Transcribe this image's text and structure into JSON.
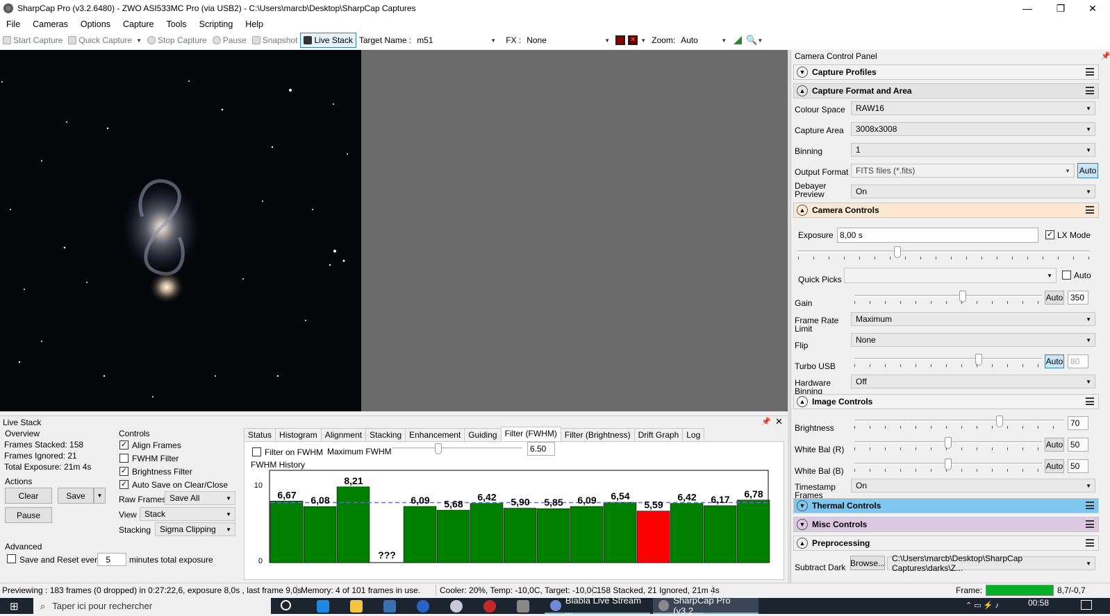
{
  "window": {
    "title": "SharpCap Pro (v3.2.6480) - ZWO ASI533MC Pro (via USB2) - C:\\Users\\marcb\\Desktop\\SharpCap Captures",
    "minimize": "—",
    "maximize": "❐",
    "close": "✕"
  },
  "menu": [
    "File",
    "Cameras",
    "Options",
    "Capture",
    "Tools",
    "Scripting",
    "Help"
  ],
  "toolbar": {
    "start_capture": "Start Capture",
    "quick_capture": "Quick Capture",
    "stop_capture": "Stop Capture",
    "pause": "Pause",
    "snapshot": "Snapshot",
    "live_stack": "Live Stack",
    "target_label": "Target Name :",
    "target_value": "m51",
    "fx_label": "FX :",
    "fx_value": "None",
    "zoom_label": "Zoom:",
    "zoom_value": "Auto"
  },
  "ccp": {
    "title": "Camera Control Panel",
    "sections": {
      "capture_profiles": "Capture Profiles",
      "capture_format": "Capture Format and Area",
      "camera_controls": "Camera Controls",
      "image_controls": "Image Controls",
      "thermal_controls": "Thermal Controls",
      "misc_controls": "Misc Controls",
      "preprocessing": "Preprocessing"
    },
    "colour_space": {
      "label": "Colour Space",
      "value": "RAW16"
    },
    "capture_area": {
      "label": "Capture Area",
      "value": "3008x3008"
    },
    "binning": {
      "label": "Binning",
      "value": "1"
    },
    "output_format": {
      "label": "Output Format",
      "value": "FITS files (*.fits)",
      "auto": "Auto"
    },
    "debayer": {
      "label1": "Debayer",
      "label2": "Preview",
      "value": "On"
    },
    "exposure": {
      "label": "Exposure",
      "value": "8,00 s",
      "lx": "LX Mode"
    },
    "quick_picks": {
      "label": "Quick Picks",
      "auto": "Auto"
    },
    "gain": {
      "label": "Gain",
      "auto": "Auto",
      "value": "350",
      "level": 0.58
    },
    "frame_rate": {
      "label1": "Frame Rate",
      "label2": "Limit",
      "value": "Maximum"
    },
    "flip": {
      "label": "Flip",
      "value": "None"
    },
    "turbo_usb": {
      "label": "Turbo USB",
      "auto": "Auto",
      "value": "80",
      "level": 0.67
    },
    "hw_binning": {
      "label1": "Hardware",
      "label2": "Binning",
      "value": "Off"
    },
    "brightness": {
      "label": "Brightness",
      "value": "70",
      "level": 0.7
    },
    "wb_r": {
      "label": "White Bal (R)",
      "auto": "Auto",
      "value": "50",
      "level": 0.5
    },
    "wb_b": {
      "label": "White Bal (B)",
      "auto": "Auto",
      "value": "50",
      "level": 0.5
    },
    "timestamp": {
      "label1": "Timestamp",
      "label2": "Frames",
      "value": "On"
    },
    "subtract_dark": {
      "label": "Subtract Dark",
      "browse": "Browse...",
      "path": "C:\\Users\\marcb\\Desktop\\SharpCap Captures\\darks\\Z..."
    }
  },
  "livestack": {
    "title": "Live Stack",
    "overview": {
      "title": "Overview",
      "stacked": "Frames Stacked:  158",
      "ignored": "Frames Ignored:  21",
      "exposure": "Total Exposure:   21m 4s"
    },
    "actions": {
      "title": "Actions",
      "clear": "Clear",
      "save": "Save",
      "pause": "Pause"
    },
    "advanced": {
      "title": "Advanced",
      "save_reset": "Save and Reset every",
      "minutes_value": "5",
      "minutes_label": "minutes total exposure"
    },
    "controls": {
      "title": "Controls",
      "align": "Align Frames",
      "fwhm": "FWHM Filter",
      "brightness": "Brightness Filter",
      "autosave": "Auto Save on Clear/Close",
      "raw_label": "Raw Frames",
      "raw_value": "Save All",
      "view_label": "View",
      "view_value": "Stack",
      "stacking_label": "Stacking",
      "stacking_value": "Sigma Clipping"
    },
    "tabs": [
      "Status",
      "Histogram",
      "Alignment",
      "Stacking",
      "Enhancement",
      "Guiding",
      "Filter (FWHM)",
      "Filter (Brightness)",
      "Drift Graph",
      "Log"
    ],
    "filter_on": "Filter on FWHM",
    "max_fwhm_label": "Maximum FWHM",
    "max_fwhm_value": "6.50"
  },
  "chart_data": {
    "type": "bar",
    "title": "FWHM History",
    "ylim": [
      0,
      10
    ],
    "yticks": [
      "10",
      "0"
    ],
    "threshold": 6.5,
    "values": [
      6.67,
      6.08,
      8.21,
      null,
      6.09,
      5.68,
      6.42,
      5.9,
      5.85,
      6.09,
      6.54,
      5.59,
      6.42,
      6.17,
      6.78
    ],
    "labels": [
      "6,67",
      "6,08",
      "8,21",
      "???",
      "6,09",
      "5,68",
      "6,42",
      "5,90",
      "5,85",
      "6,09",
      "6,54",
      "5,59",
      "6,42",
      "6,17",
      "6,78"
    ],
    "highlight_index": 11,
    "bar_color": "#008000",
    "highlight_color": "#ff0000"
  },
  "status": {
    "preview": "Previewing : 183 frames (0 dropped) in 0:27:22,6, exposure 8,0s , last frame 9,0s",
    "memory": "Memory: 4 of 101 frames in use.",
    "cooler": "Cooler: 20%, Temp: -10,0C, Target: -10,0C",
    "stacked": "158 Stacked, 21 Ignored, 21m 4s",
    "frame_label": "Frame:",
    "frame_value": "8,7/-0,7"
  },
  "taskbar": {
    "search": "Taper ici pour rechercher",
    "discord": "Blabla Live Stream ...",
    "sharpcap": "SharpCap Pro (v3.2....",
    "time": "00:58"
  }
}
